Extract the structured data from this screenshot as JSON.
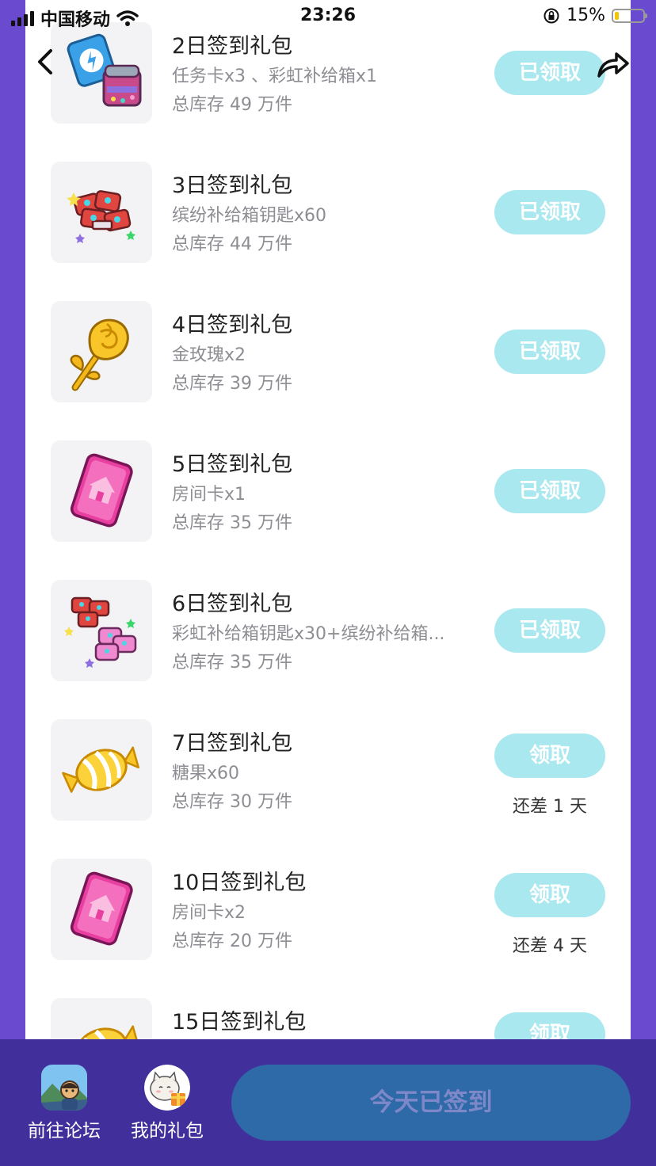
{
  "status_bar": {
    "carrier": "中国移动",
    "time": "23:26",
    "battery": "15%"
  },
  "gifts": [
    {
      "title": "2日签到礼包",
      "desc": "任务卡x3 、彩虹补给箱x1",
      "stock": "总库存 49 万件",
      "button": "已领取",
      "remaining": "",
      "icon": "task-card-and-supply-box"
    },
    {
      "title": "3日签到礼包",
      "desc": "缤纷补给箱钥匙x60",
      "stock": "总库存 44 万件",
      "button": "已领取",
      "remaining": "",
      "icon": "colorful-key-pile"
    },
    {
      "title": "4日签到礼包",
      "desc": "金玫瑰x2",
      "stock": "总库存 39 万件",
      "button": "已领取",
      "remaining": "",
      "icon": "golden-rose"
    },
    {
      "title": "5日签到礼包",
      "desc": "房间卡x1",
      "stock": "总库存 35 万件",
      "button": "已领取",
      "remaining": "",
      "icon": "room-card"
    },
    {
      "title": "6日签到礼包",
      "desc": "彩虹补给箱钥匙x30+缤纷补给箱...",
      "stock": "总库存 35 万件",
      "button": "已领取",
      "remaining": "",
      "icon": "rainbow-and-colorful-keys"
    },
    {
      "title": "7日签到礼包",
      "desc": "糖果x60",
      "stock": "总库存 30 万件",
      "button": "领取",
      "remaining": "还差 1 天",
      "icon": "candy"
    },
    {
      "title": "10日签到礼包",
      "desc": "房间卡x2",
      "stock": "总库存 20 万件",
      "button": "领取",
      "remaining": "还差 4 天",
      "icon": "room-card"
    },
    {
      "title": "15日签到礼包",
      "desc": "",
      "stock": "",
      "button": "领取",
      "remaining": "",
      "icon": "candy"
    }
  ],
  "bottom_bar": {
    "forum_label": "前往论坛",
    "gifts_label": "我的礼包",
    "checkin_label": "今天已签到"
  },
  "colors": {
    "background": "#6a4bd0",
    "bottom_bar": "#41309b",
    "button": "#a9e8ee",
    "checkin_button": "#2f6aa8"
  }
}
